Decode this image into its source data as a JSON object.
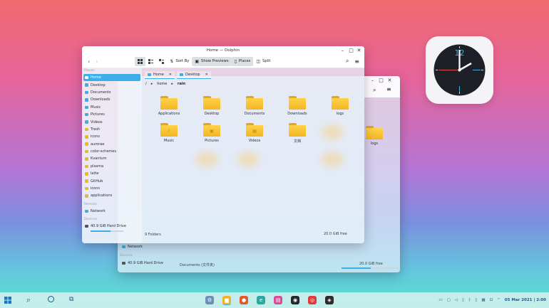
{
  "main_window": {
    "title": "Home — Dolphin",
    "toolbar": {
      "sort_label": "Sort By",
      "previews_label": "Show Previews",
      "places_label": "Places",
      "split_label": "Split"
    },
    "places_header": "Places",
    "remote_header": "Remote",
    "devices_header": "Devices",
    "places": [
      {
        "label": "Home",
        "selected": true
      },
      {
        "label": "Desktop"
      },
      {
        "label": "Documents"
      },
      {
        "label": "Downloads"
      },
      {
        "label": "Music"
      },
      {
        "label": "Pictures"
      },
      {
        "label": "Videos"
      },
      {
        "label": "Trash"
      },
      {
        "label": "icons"
      },
      {
        "label": "aurorae"
      },
      {
        "label": "color-schemes"
      },
      {
        "label": "Kvantum"
      },
      {
        "label": "plasma"
      },
      {
        "label": "latte"
      },
      {
        "label": "GitHub"
      },
      {
        "label": "icons"
      },
      {
        "label": "applications"
      }
    ],
    "remote": [
      {
        "label": "Network"
      }
    ],
    "devices": [
      {
        "label": "40.9 GiB Hard Drive"
      }
    ],
    "tabs": [
      {
        "label": "Home"
      },
      {
        "label": "Desktop"
      }
    ],
    "breadcrumb": [
      "/",
      "home",
      "rain"
    ],
    "folders": [
      {
        "label": "Applications"
      },
      {
        "label": "Desktop"
      },
      {
        "label": "Documents"
      },
      {
        "label": "Downloads"
      },
      {
        "label": "logs"
      },
      {
        "label": "Music"
      },
      {
        "label": "Pictures"
      },
      {
        "label": "Videos"
      },
      {
        "label": "文档"
      }
    ],
    "status_count": "9 Folders",
    "free_space": "20.0 GiB free",
    "free_fraction": 0.51
  },
  "back_window": {
    "folder_label": "logs",
    "remote_item": "Network",
    "devices_header": "Devices",
    "device_item": "40.9 GiB Hard Drive",
    "status_text": "Documents (文件夹)",
    "free_space": "20.0 GiB free",
    "free_fraction": 0.51
  },
  "taskbar": {
    "datetime": "05 Mar 2021 | 2:00",
    "accent": "#3daee9"
  }
}
